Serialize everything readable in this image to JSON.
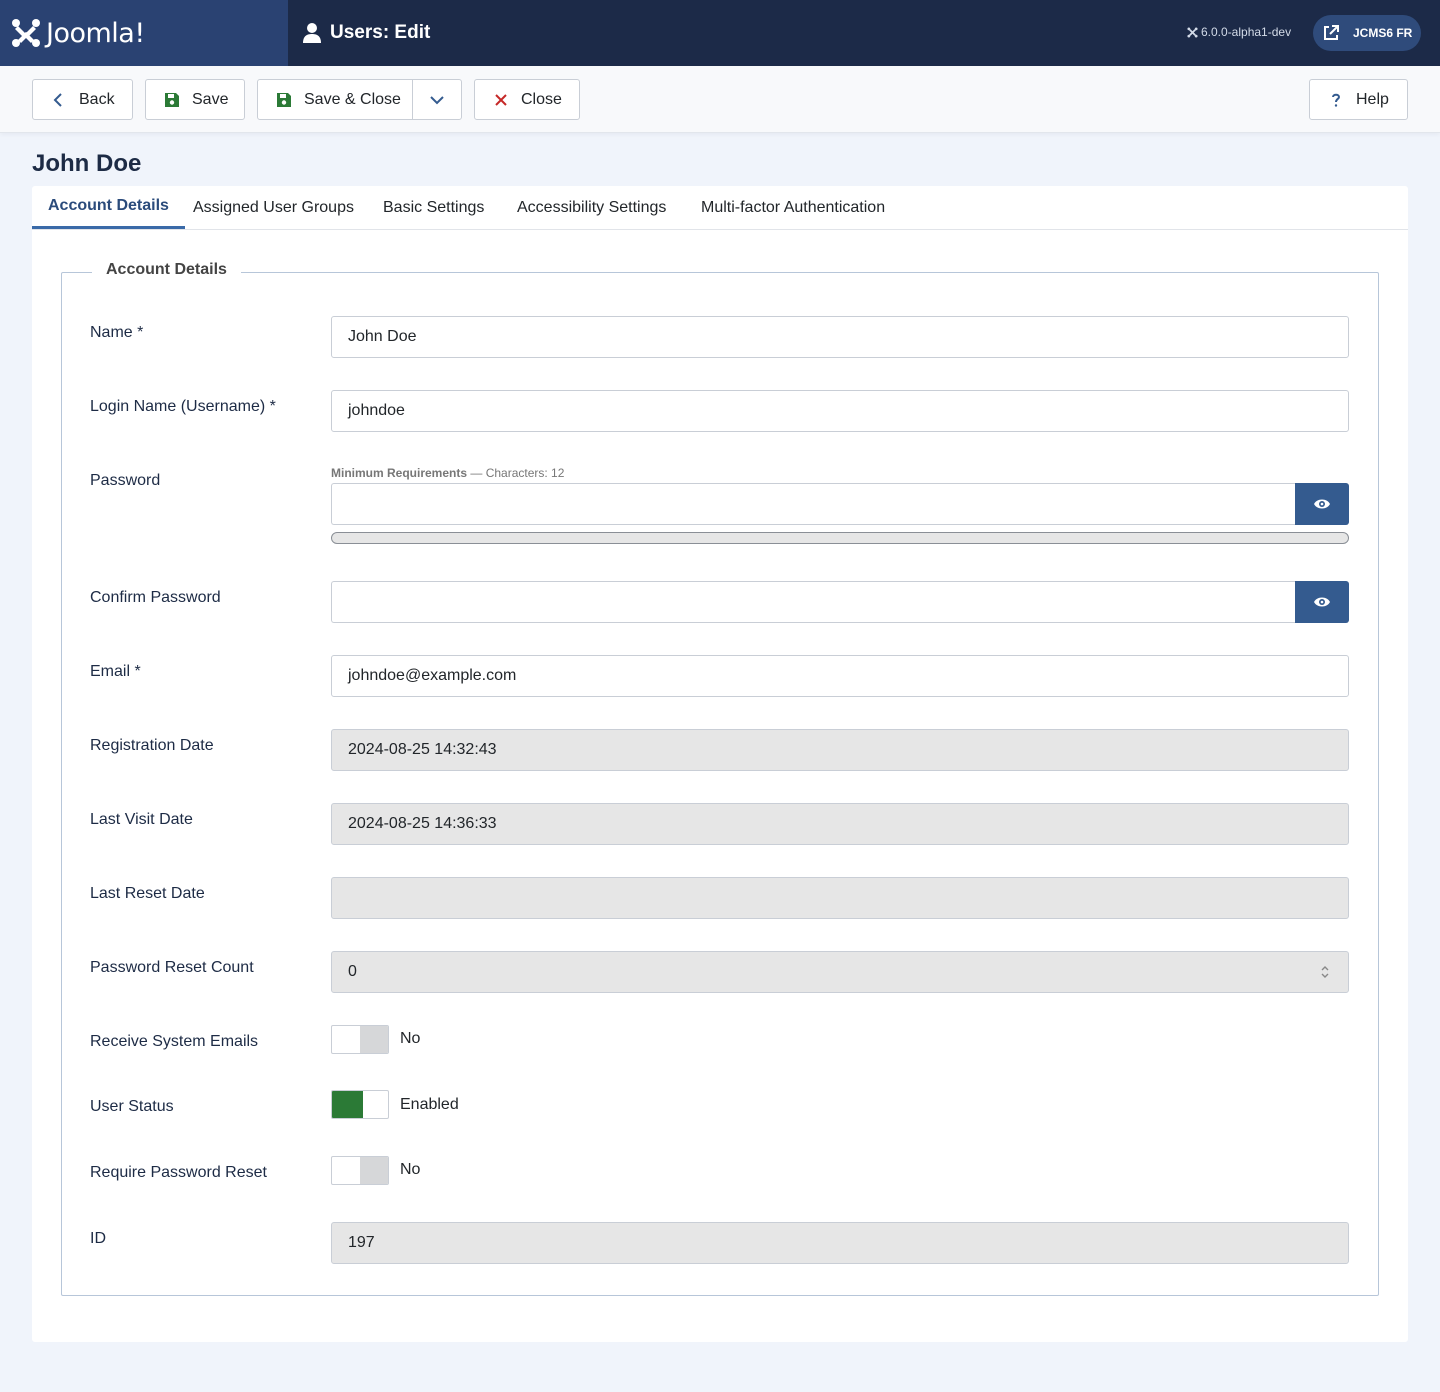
{
  "header": {
    "logo_text": "Joomla!",
    "page_title": "Users: Edit",
    "version": "6.0.0-alpha1-dev",
    "site_button": "JCMS6 FR"
  },
  "toolbar": {
    "back": "Back",
    "save": "Save",
    "save_close": "Save & Close",
    "close": "Close",
    "help": "Help"
  },
  "page": {
    "title": "John Doe"
  },
  "tabs": [
    {
      "label": "Account Details",
      "active": true
    },
    {
      "label": "Assigned User Groups",
      "active": false
    },
    {
      "label": "Basic Settings",
      "active": false
    },
    {
      "label": "Accessibility Settings",
      "active": false
    },
    {
      "label": "Multi-factor Authentication",
      "active": false
    }
  ],
  "form": {
    "legend": "Account Details",
    "name": {
      "label": "Name *",
      "value": "John Doe"
    },
    "username": {
      "label": "Login Name (Username) *",
      "value": "johndoe"
    },
    "password": {
      "label": "Password",
      "requirements_title": "Minimum Requirements",
      "requirements_detail": " — Characters: 12",
      "value": ""
    },
    "confirm_password": {
      "label": "Confirm Password",
      "value": ""
    },
    "email": {
      "label": "Email *",
      "value": "johndoe@example.com"
    },
    "registration_date": {
      "label": "Registration Date",
      "value": "2024-08-25 14:32:43"
    },
    "last_visit_date": {
      "label": "Last Visit Date",
      "value": "2024-08-25 14:36:33"
    },
    "last_reset_date": {
      "label": "Last Reset Date",
      "value": ""
    },
    "reset_count": {
      "label": "Password Reset Count",
      "value": "0"
    },
    "receive_emails": {
      "label": "Receive System Emails",
      "state": "No",
      "on": false
    },
    "user_status": {
      "label": "User Status",
      "state": "Enabled",
      "on": true
    },
    "require_reset": {
      "label": "Require Password Reset",
      "state": "No",
      "on": false
    },
    "id": {
      "label": "ID",
      "value": "197"
    }
  },
  "colors": {
    "header_bg": "#1c2a48",
    "logo_bg": "#2a4272",
    "accent": "#345b8f",
    "switch_on": "#2b7a36",
    "save_icon": "#2b7a36",
    "close_icon": "#c52827"
  }
}
